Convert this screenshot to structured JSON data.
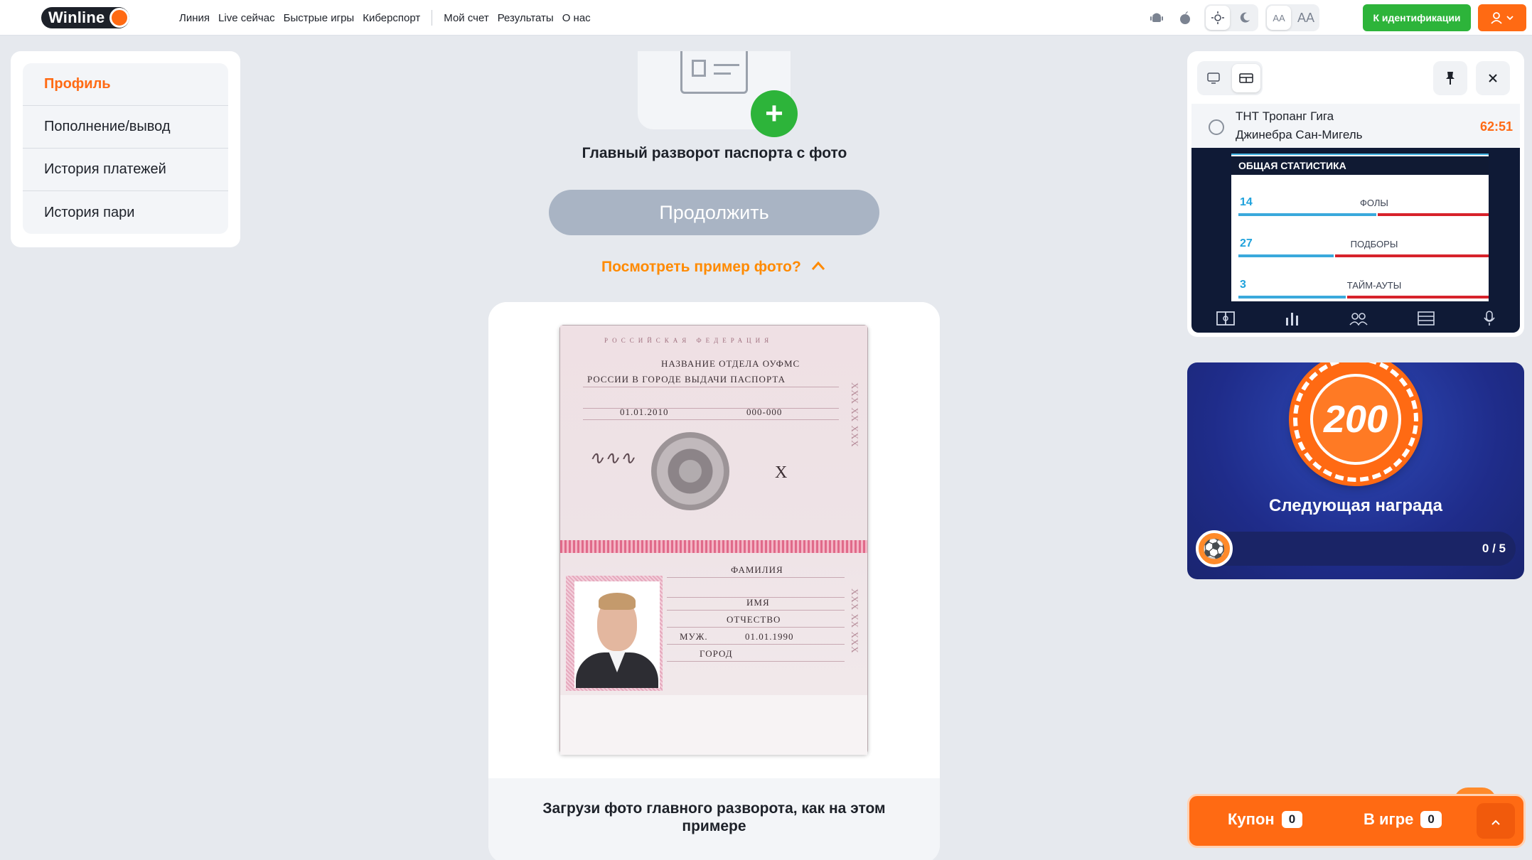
{
  "header": {
    "logo_text": "Winline",
    "nav": [
      "Линия",
      "Live сейчас",
      "Быстрые игры",
      "Киберспорт"
    ],
    "nav2": [
      "Мой счет",
      "Результаты",
      "О нас"
    ],
    "font_small": "AA",
    "font_big": "AA",
    "ident_label": "К идентификации"
  },
  "sidebar": {
    "items": [
      {
        "label": "Профиль"
      },
      {
        "label": "Пополнение/вывод"
      },
      {
        "label": "История платежей"
      },
      {
        "label": "История пари"
      }
    ]
  },
  "upload": {
    "title": "Главный разворот паспорта с фото",
    "continue_label": "Продолжить",
    "example_link": "Посмотреть пример фото?",
    "example_caption": "Загрузи фото главного разворота, как на этом примере"
  },
  "passport": {
    "country": "РОССИЙСКАЯ ФЕДЕРАЦИЯ",
    "issuer_line1": "НАЗВАНИЕ ОТДЕЛА ОУФМС",
    "issuer_line2": "РОССИИ В ГОРОДЕ ВЫДАЧИ ПАСПОРТА",
    "issue_date": "01.01.2010",
    "dept_code": "000-000",
    "mark": "X",
    "surname": "ФАМИЛИЯ",
    "name": "ИМЯ",
    "patronymic": "ОТЧЕСТВО",
    "sex": "МУЖ.",
    "birth_date": "01.01.1990",
    "birth_place": "ГОРОД"
  },
  "stats_widget": {
    "team1": "ТНТ Тропанг Гига",
    "team2": "Джинебра Сан-Мигель",
    "time": "62:51",
    "panel_title": "ОБЩАЯ СТАТИСТИКА",
    "stats": [
      {
        "value": "14",
        "name": "ФОЛЫ",
        "left_ratio": 0.55
      },
      {
        "value": "27",
        "name": "ПОДБОРЫ",
        "left_ratio": 0.38
      },
      {
        "value": "3",
        "name": "ТАЙМ-АУТЫ",
        "left_ratio": 0.43
      }
    ]
  },
  "reward": {
    "chip_value": "200",
    "title": "Следующая награда",
    "count": "0 / 5"
  },
  "bet_bar": {
    "coupon_label": "Купон",
    "coupon_count": "0",
    "ingame_label": "В игре",
    "ingame_count": "0"
  },
  "colors": {
    "brand_orange": "#ff6a13",
    "green": "#2db43a",
    "link_orange": "#ff8a00"
  }
}
